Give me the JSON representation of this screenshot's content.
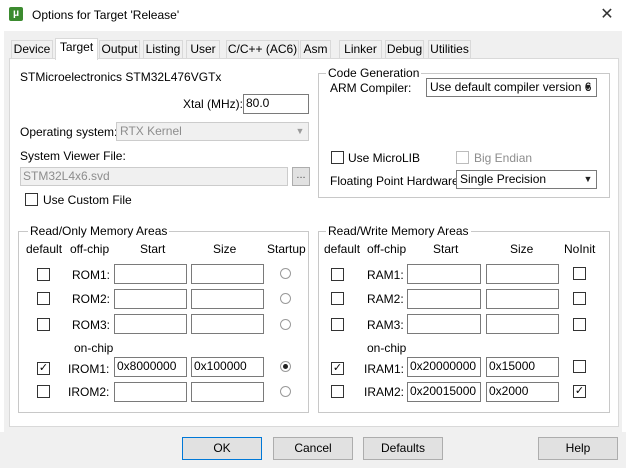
{
  "window": {
    "title": "Options for Target 'Release'"
  },
  "tabs": [
    "Device",
    "Target",
    "Output",
    "Listing",
    "User",
    "C/C++ (AC6)",
    "Asm",
    "Linker",
    "Debug",
    "Utilities"
  ],
  "device": {
    "name": "STMicroelectronics STM32L476VGTx"
  },
  "xtal": {
    "label": "Xtal (MHz):",
    "value": "80.0"
  },
  "os": {
    "label": "Operating system:",
    "value": "RTX Kernel"
  },
  "svd": {
    "label": "System Viewer File:",
    "value": "STM32L4x6.svd",
    "browse": "...",
    "custom_label": "Use Custom File",
    "custom_checked": false
  },
  "codegen": {
    "title": "Code Generation",
    "compiler_label": "ARM Compiler:",
    "compiler_value": "Use default compiler version 6",
    "microlib_label": "Use MicroLIB",
    "microlib_checked": false,
    "bigendian_label": "Big Endian",
    "bigendian_checked": false,
    "fph_label": "Floating Point Hardware:",
    "fph_value": "Single Precision"
  },
  "rom": {
    "title": "Read/Only Memory Areas",
    "headers": {
      "default": "default",
      "offchip": "off-chip",
      "start": "Start",
      "size": "Size",
      "last": "Startup"
    },
    "onchip_label": "on-chip",
    "rows": [
      {
        "name": "ROM1:",
        "start": "",
        "size": "",
        "checked": false,
        "selected": false
      },
      {
        "name": "ROM2:",
        "start": "",
        "size": "",
        "checked": false,
        "selected": false
      },
      {
        "name": "ROM3:",
        "start": "",
        "size": "",
        "checked": false,
        "selected": false
      },
      {
        "name": "IROM1:",
        "start": "0x8000000",
        "size": "0x100000",
        "checked": true,
        "selected": true
      },
      {
        "name": "IROM2:",
        "start": "",
        "size": "",
        "checked": false,
        "selected": false
      }
    ]
  },
  "ram": {
    "title": "Read/Write Memory Areas",
    "headers": {
      "default": "default",
      "offchip": "off-chip",
      "start": "Start",
      "size": "Size",
      "last": "NoInit"
    },
    "onchip_label": "on-chip",
    "rows": [
      {
        "name": "RAM1:",
        "start": "",
        "size": "",
        "checked": false,
        "noinit": false
      },
      {
        "name": "RAM2:",
        "start": "",
        "size": "",
        "checked": false,
        "noinit": false
      },
      {
        "name": "RAM3:",
        "start": "",
        "size": "",
        "checked": false,
        "noinit": false
      },
      {
        "name": "IRAM1:",
        "start": "0x20000000",
        "size": "0x15000",
        "checked": true,
        "noinit": false
      },
      {
        "name": "IRAM2:",
        "start": "0x20015000",
        "size": "0x2000",
        "checked": false,
        "noinit": true
      }
    ]
  },
  "buttons": {
    "ok": "OK",
    "cancel": "Cancel",
    "defaults": "Defaults",
    "help": "Help"
  },
  "colors": {
    "accent": "#0078d7",
    "dialog_bg": "#f0f0f0",
    "app_icon": "#3c8b2f"
  }
}
